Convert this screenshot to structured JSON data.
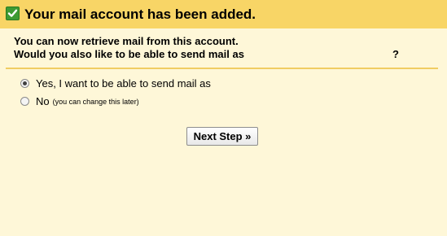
{
  "header": {
    "title": "Your mail account has been added.",
    "icon": "checkmark-icon"
  },
  "intro": {
    "line1": "You can now retrieve mail from this account.",
    "line2": "Would you also like to be able to send mail as",
    "question_mark": "?"
  },
  "options": {
    "yes_label": "Yes, I want to be able to send mail as",
    "no_label": "No",
    "no_hint": "(you can change this later)",
    "selected": "yes"
  },
  "actions": {
    "next_label": "Next Step »"
  },
  "colors": {
    "header_bg": "#f8d566",
    "page_bg": "#fef7d8",
    "check_bg": "#3d9a33"
  }
}
